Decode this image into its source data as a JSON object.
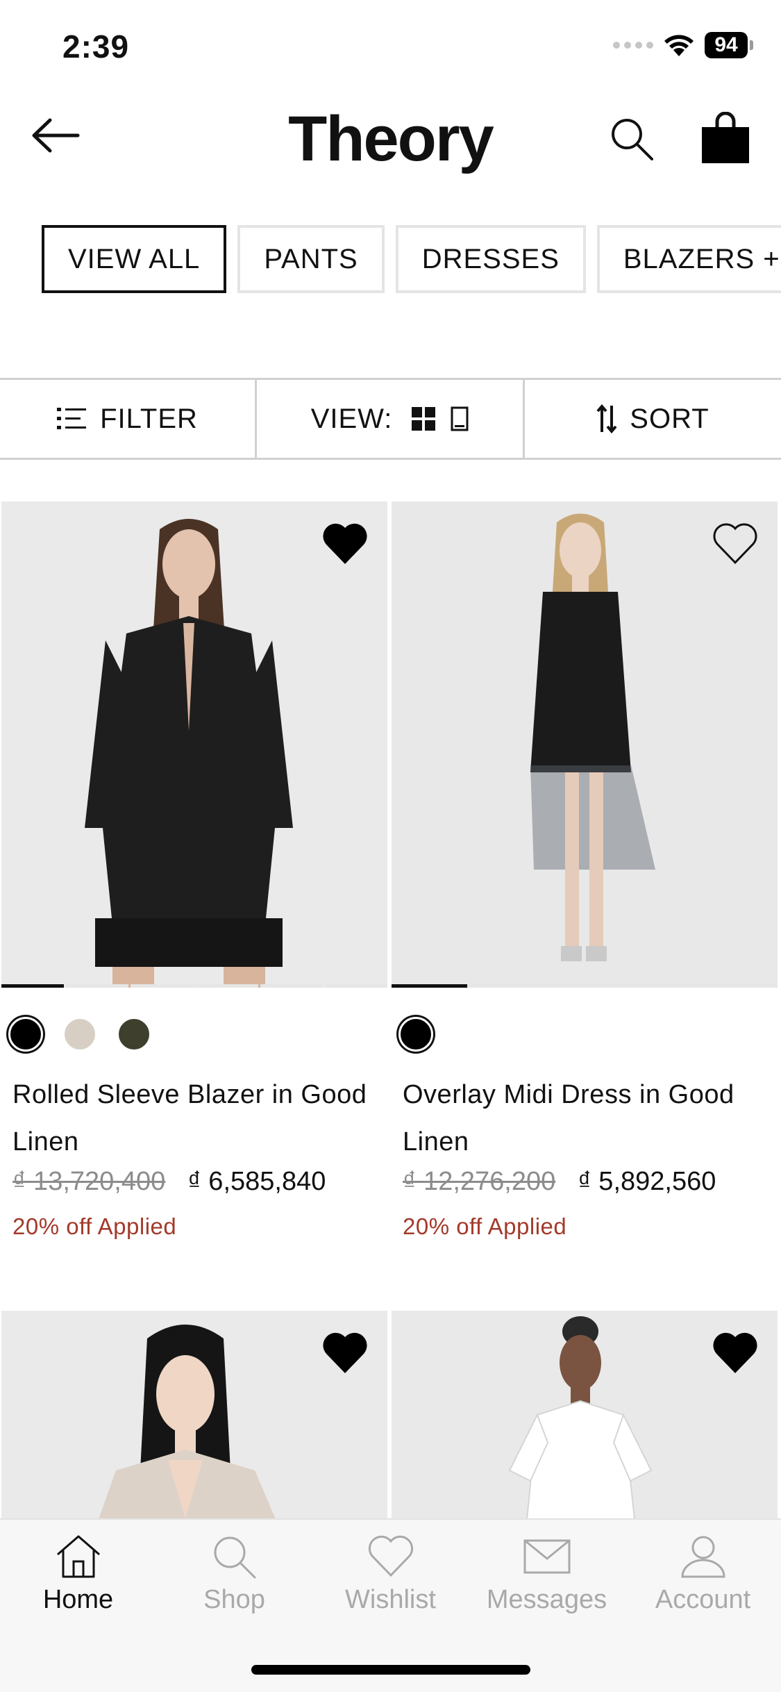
{
  "status_bar": {
    "time": "2:39",
    "battery": "94"
  },
  "header": {
    "brand": "Theory"
  },
  "categories": [
    "VIEW ALL",
    "PANTS",
    "DRESSES",
    "BLAZERS + JACKETS"
  ],
  "toolbar": {
    "filter_label": "FILTER",
    "view_label": "VIEW:",
    "sort_label": "SORT"
  },
  "products": [
    {
      "name": "Rolled Sleeve Blazer in Good Linen",
      "price_original": "₫ 13,720,400",
      "price_sale": "₫ 6,585,840",
      "promo": "20% off Applied",
      "wishlisted": true,
      "swatches": [
        "#000000",
        "#d8cfc4",
        "#3f3f2e"
      ]
    },
    {
      "name": "Overlay Midi Dress in Good Linen",
      "price_original": "₫ 12,276,200",
      "price_sale": "₫ 5,892,560",
      "promo": "20% off Applied",
      "wishlisted": false,
      "swatches": [
        "#000000"
      ]
    },
    {
      "wishlisted": true
    },
    {
      "wishlisted": true
    }
  ],
  "tabbar": {
    "items": [
      {
        "label": "Home",
        "icon": "home-icon",
        "active": true
      },
      {
        "label": "Shop",
        "icon": "search-icon",
        "active": false
      },
      {
        "label": "Wishlist",
        "icon": "heart-icon",
        "active": false
      },
      {
        "label": "Messages",
        "icon": "envelope-icon",
        "active": false
      },
      {
        "label": "Account",
        "icon": "person-icon",
        "active": false
      }
    ]
  },
  "colors": {
    "accent": "#111111",
    "promo": "#a33a2a",
    "inactive_tab": "#a9a9a9"
  }
}
